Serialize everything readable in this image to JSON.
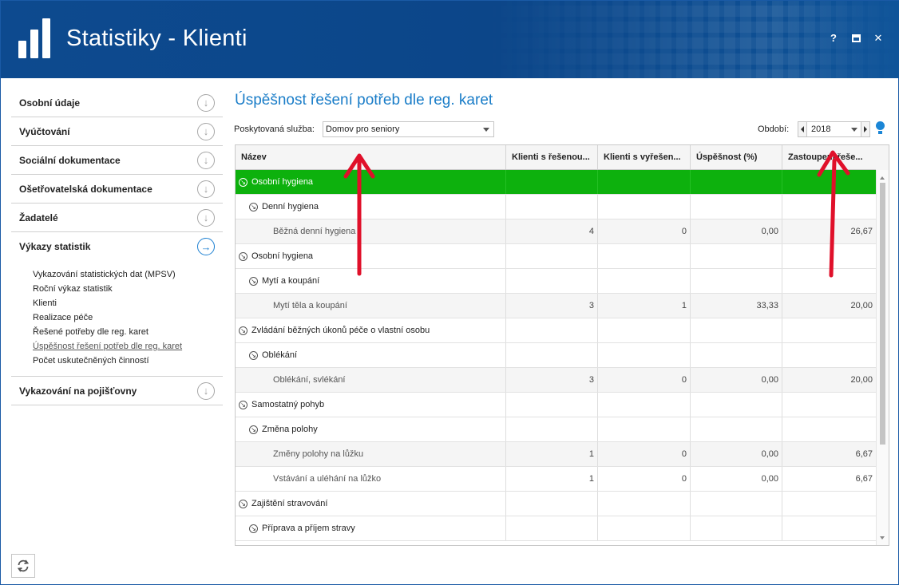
{
  "window": {
    "title": "Statistiky - Klienti",
    "help_label": "?",
    "close_label": "✕"
  },
  "sidebar": {
    "items": [
      {
        "label": "Osobní údaje"
      },
      {
        "label": "Vyúčtování"
      },
      {
        "label": "Sociální dokumentace"
      },
      {
        "label": "Ošetřovatelská dokumentace"
      },
      {
        "label": "Žadatelé"
      },
      {
        "label": "Výkazy statistik"
      },
      {
        "label": "Vykazování na pojišťovny"
      }
    ],
    "sub_items": [
      {
        "label": "Vykazování statistických dat (MPSV)"
      },
      {
        "label": "Roční výkaz statistik"
      },
      {
        "label": "Klienti"
      },
      {
        "label": "Realizace péče"
      },
      {
        "label": "Řešené potřeby dle reg. karet"
      },
      {
        "label": "Úspěšnost řešení potřeb dle reg. karet"
      },
      {
        "label": "Počet uskutečněných činností"
      }
    ]
  },
  "main": {
    "title": "Úspěšnost řešení potřeb dle reg. karet",
    "service_label": "Poskytovaná služba:",
    "service_value": "Domov pro seniory",
    "period_label": "Období:",
    "period_value": "2018"
  },
  "grid": {
    "columns": [
      "Název",
      "Klienti s řešenou...",
      "Klienti s vyřešen...",
      "Úspěšnost (%)",
      "Zastoupení řeše..."
    ],
    "rows": [
      {
        "name": "Osobní hygiena",
        "level": 0,
        "c1": "",
        "c2": "",
        "c3": "",
        "c4": ""
      },
      {
        "name": "Denní hygiena",
        "level": 1,
        "c1": "",
        "c2": "",
        "c3": "",
        "c4": ""
      },
      {
        "name": "Běžná denní hygiena",
        "level": 2,
        "c1": "4",
        "c2": "0",
        "c3": "0,00",
        "c4": "26,67"
      },
      {
        "name": "Osobní hygiena",
        "level": 0,
        "c1": "",
        "c2": "",
        "c3": "",
        "c4": ""
      },
      {
        "name": "Mytí a koupání",
        "level": 1,
        "c1": "",
        "c2": "",
        "c3": "",
        "c4": ""
      },
      {
        "name": "Mytí těla a koupání",
        "level": 2,
        "c1": "3",
        "c2": "1",
        "c3": "33,33",
        "c4": "20,00"
      },
      {
        "name": "Zvládání běžných úkonů péče o vlastní osobu",
        "level": 0,
        "c1": "",
        "c2": "",
        "c3": "",
        "c4": ""
      },
      {
        "name": "Oblékání",
        "level": 1,
        "c1": "",
        "c2": "",
        "c3": "",
        "c4": ""
      },
      {
        "name": "Oblékání, svlékání",
        "level": 2,
        "c1": "3",
        "c2": "0",
        "c3": "0,00",
        "c4": "20,00"
      },
      {
        "name": "Samostatný pohyb",
        "level": 0,
        "c1": "",
        "c2": "",
        "c3": "",
        "c4": ""
      },
      {
        "name": "Změna polohy",
        "level": 1,
        "c1": "",
        "c2": "",
        "c3": "",
        "c4": ""
      },
      {
        "name": "Změny polohy na lůžku",
        "level": 2,
        "c1": "1",
        "c2": "0",
        "c3": "0,00",
        "c4": "6,67"
      },
      {
        "name": "Vstávání a uléhání na lůžko",
        "level": 2,
        "c1": "1",
        "c2": "0",
        "c3": "0,00",
        "c4": "6,67"
      },
      {
        "name": "Zajištění stravování",
        "level": 0,
        "c1": "",
        "c2": "",
        "c3": "",
        "c4": ""
      },
      {
        "name": "Příprava a příjem stravy",
        "level": 1,
        "c1": "",
        "c2": "",
        "c3": "",
        "c4": ""
      }
    ]
  },
  "colors": {
    "title_bar": "#0d4a8f",
    "accent": "#1a7dc8",
    "selected_row": "#0db10d",
    "annotation_arrow": "#e0102a"
  }
}
